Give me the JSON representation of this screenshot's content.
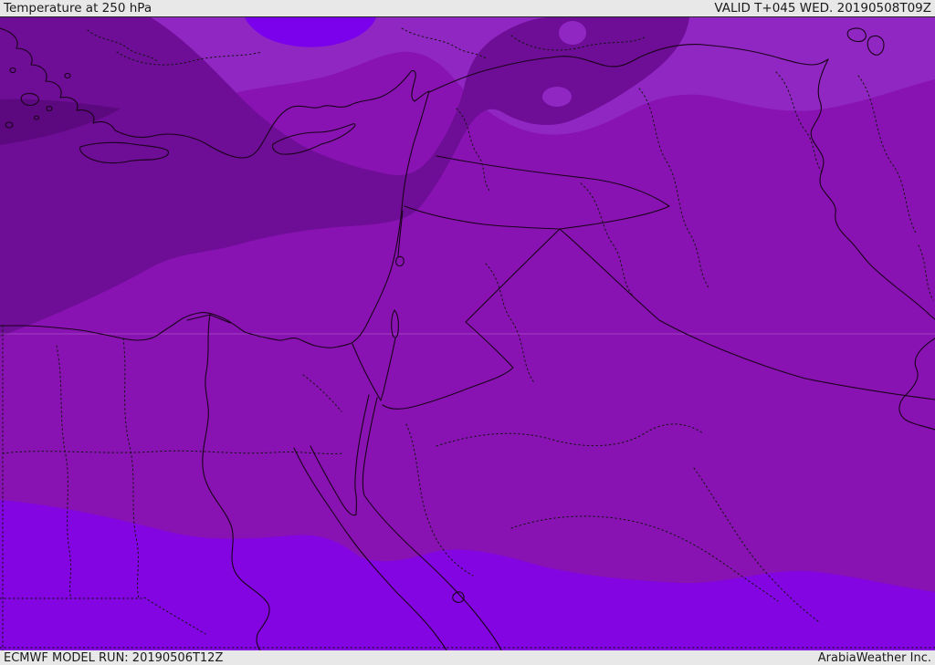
{
  "header": {
    "title": "Temperature at 250 hPa",
    "valid_label": "VALID T+045 WED. 20190508T09Z"
  },
  "footer": {
    "model_run_label": "ECMWF MODEL RUN: 20190506T12Z",
    "credit_label": "ArabiaWeather Inc."
  },
  "colors": {
    "header_bg": "#e8e8e8",
    "text": "#1a1a1a",
    "band_coldest": "#5c0980",
    "band_very_cold": "#6e0d96",
    "band_cold": "#8813b2",
    "band_mild": "#9027c2",
    "band_warm": "#8205e2",
    "band_warm_patch": "#7b00ec",
    "coast_line": "#190019",
    "admin_dotted_line": "#141414",
    "grid_line": "#c87fd8"
  }
}
